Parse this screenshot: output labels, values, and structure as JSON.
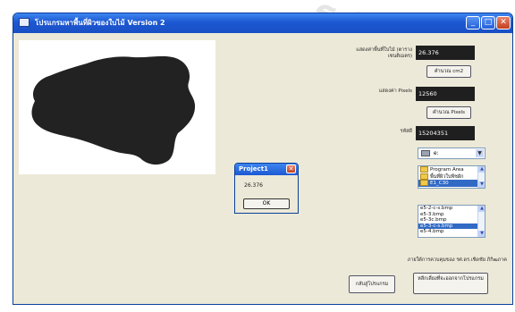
{
  "window": {
    "title": "โปรแกรมหาพื้นที่ผิวของใบไม้ Version 2",
    "minimize": "_",
    "maximize": "□",
    "close": "✕"
  },
  "area": {
    "label": "แสดงค่าพื้นที่ใบไม้ (ตารางเซนติเมตร)",
    "value": "26.376",
    "button": "คำนวณ cm2"
  },
  "pixel": {
    "label": "แสดงค่า Pixels",
    "value": "12560",
    "button": "คำนวณ Pixels"
  },
  "id": {
    "label": "รหัสดี",
    "value": "15204351"
  },
  "drive": {
    "value": "e:"
  },
  "folders": [
    "Program Area",
    "พื้นที่ผิวใบพืชผัก",
    "E1_C30"
  ],
  "files": [
    "e5-2-c-s.bmp",
    "e5-3.bmp",
    "e5-3c.bmp",
    "e5-3-c-s.bmp",
    "e5-4.bmp"
  ],
  "selected_file_index": 3,
  "credit": "ภายใต้การควบคุมของ รศ.ดร.เชิดชัย ภิกิฒภาค",
  "buttons": {
    "back": "กลับสู่โปรแกรม",
    "exit": "หลีกเลี่ยงที่จะออกจากโปรแกรม"
  },
  "msgbox": {
    "title": "Project1",
    "text": "26.376",
    "ok": "OK"
  },
  "watermark": "ร.จ.ล.ม"
}
